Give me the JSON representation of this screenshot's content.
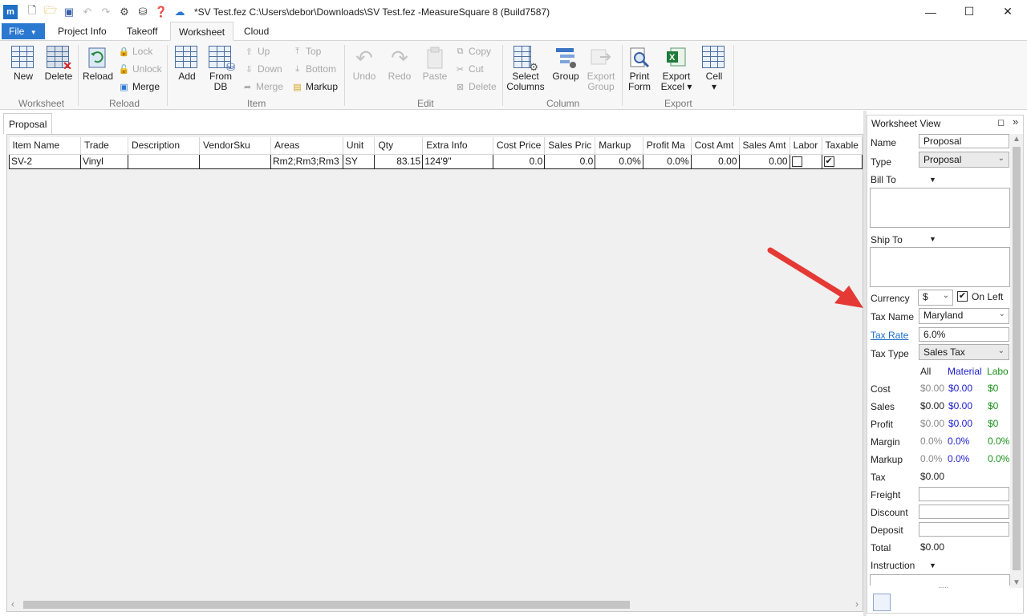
{
  "window": {
    "title": "*SV Test.fez C:\\Users\\debor\\Downloads\\SV Test.fez -MeasureSquare 8 (Build7587)",
    "app_logo": "m",
    "minimize": "—",
    "maximize": "☐",
    "close": "✕"
  },
  "ribbon_tabs": {
    "file": "File",
    "file_arrow": "▼",
    "project_info": "Project Info",
    "takeoff": "Takeoff",
    "worksheet": "Worksheet",
    "cloud": "Cloud"
  },
  "ribbon": {
    "worksheet_group": {
      "label": "Worksheet",
      "new": "New",
      "delete": "Delete"
    },
    "reload_group": {
      "label": "Reload",
      "reload": "Reload",
      "lock": "Lock",
      "unlock": "Unlock",
      "merge": "Merge"
    },
    "item_group": {
      "label": "Item",
      "add": "Add",
      "from_db_1": "From",
      "from_db_2": "DB",
      "up": "Up",
      "down": "Down",
      "merge": "Merge",
      "top": "Top",
      "bottom": "Bottom",
      "markup": "Markup"
    },
    "edit_group": {
      "label": "Edit",
      "undo": "Undo",
      "redo": "Redo",
      "paste": "Paste",
      "copy": "Copy",
      "cut": "Cut",
      "delete": "Delete"
    },
    "column_group": {
      "label": "Column",
      "select_columns_1": "Select",
      "select_columns_2": "Columns",
      "group": "Group",
      "export_group_1": "Export",
      "export_group_2": "Group"
    },
    "export_group": {
      "label": "Export",
      "print_form_1": "Print",
      "print_form_2": "Form",
      "export_excel_1": "Export",
      "export_excel_2": "Excel ▾",
      "cell": "Cell",
      "cell_arrow": "▾"
    }
  },
  "document_tab": "Proposal",
  "grid": {
    "columns": [
      "Item Name",
      "Trade",
      "Description",
      "VendorSku",
      "Areas",
      "Unit",
      "Qty",
      "Extra Info",
      "Cost Price",
      "Sales Pric",
      "Markup",
      "Profit Ma",
      "Cost Amt",
      "Sales Amt",
      "Labor",
      "Taxable"
    ],
    "rows": [
      {
        "item_name": "SV-2",
        "trade": "Vinyl",
        "description": "",
        "vendor_sku": "",
        "areas": "Rm2;Rm3;Rm3",
        "unit": "SY",
        "qty": "83.15",
        "extra_info": "124'9\"",
        "cost_price": "0.0",
        "sales_price": "0.0",
        "markup": "0.0%",
        "profit_margin": "0.0%",
        "cost_amt": "0.00",
        "sales_amt": "0.00",
        "labor": false,
        "taxable": true
      }
    ]
  },
  "checkmark": "✔",
  "worksheet_view": {
    "title": "Worksheet View",
    "restore_icon": "◻",
    "expand_icon": "»",
    "name_label": "Name",
    "name_value": "Proposal",
    "type_label": "Type",
    "type_value": "Proposal",
    "bill_to_label": "Bill To",
    "ship_to_label": "Ship To",
    "currency_label": "Currency",
    "currency_value": "$",
    "on_left_label": "On Left",
    "on_left_checked": true,
    "tax_name_label": "Tax Name",
    "tax_name_value": "Maryland",
    "tax_rate_label": "Tax Rate",
    "tax_rate_value": "6.0%",
    "tax_type_label": "Tax Type",
    "tax_type_value": "Sales Tax",
    "summary_headers": {
      "all": "All",
      "material": "Material",
      "labor": "Labo"
    },
    "summary": [
      {
        "label": "Cost",
        "all": "$0.00",
        "material": "$0.00",
        "labor": "$0"
      },
      {
        "label": "Sales",
        "all": "$0.00",
        "material": "$0.00",
        "labor": "$0"
      },
      {
        "label": "Profit",
        "all": "$0.00",
        "material": "$0.00",
        "labor": "$0"
      },
      {
        "label": "Margin",
        "all": "0.0%",
        "material": "0.0%",
        "labor": "0.0%"
      },
      {
        "label": "Markup",
        "all": "0.0%",
        "material": "0.0%",
        "labor": "0.0%"
      }
    ],
    "tax_label": "Tax",
    "tax_value": "$0.00",
    "freight_label": "Freight",
    "freight_value": "",
    "discount_label": "Discount",
    "discount_value": "",
    "deposit_label": "Deposit",
    "deposit_value": "",
    "total_label": "Total",
    "total_value": "$0.00",
    "instruction_label": "Instruction",
    "grip": "·····"
  },
  "colors": {
    "accent": "#2b78d0",
    "material_text": "#1c1ccf",
    "labor_text": "#1a8f1a",
    "annotation_arrow": "#e53935"
  }
}
